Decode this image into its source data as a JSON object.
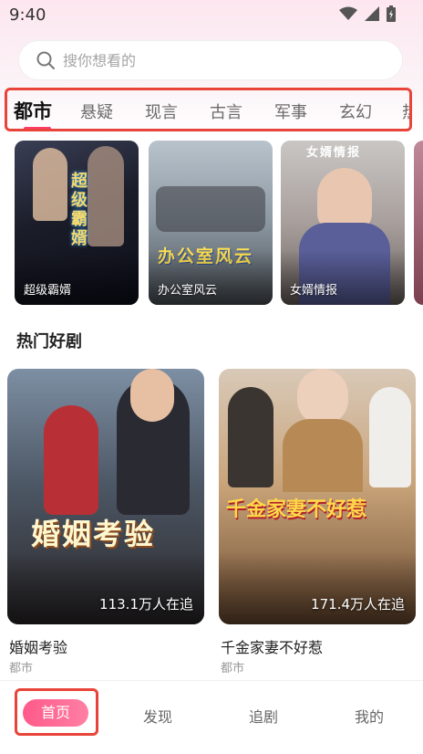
{
  "status": {
    "time": "9:40"
  },
  "search": {
    "placeholder": "搜你想看的"
  },
  "tabs": [
    {
      "label": "都市",
      "active": true
    },
    {
      "label": "悬疑"
    },
    {
      "label": "现言"
    },
    {
      "label": "古言"
    },
    {
      "label": "军事"
    },
    {
      "label": "玄幻"
    },
    {
      "label": "热血"
    }
  ],
  "featured": [
    {
      "title": "超级霸婿",
      "poster_text": "超级霸婿"
    },
    {
      "title": "办公室风云",
      "poster_text": "办公室风云"
    },
    {
      "title": "女婿情报",
      "poster_text": "女婿情报"
    }
  ],
  "section": {
    "title": "热门好剧"
  },
  "hot": [
    {
      "title": "婚姻考验",
      "category": "都市",
      "followers": "113.1万人在追",
      "poster_text": "婚姻考验"
    },
    {
      "title": "千金家妻不好惹",
      "category": "都市",
      "followers": "171.4万人在追",
      "poster_text": "千金家妻不好惹"
    }
  ],
  "nav": {
    "home": "首页",
    "discover": "发现",
    "follow": "追剧",
    "mine": "我的"
  },
  "colors": {
    "accent": "#ff5a8a",
    "highlight_border": "#e8443a"
  }
}
